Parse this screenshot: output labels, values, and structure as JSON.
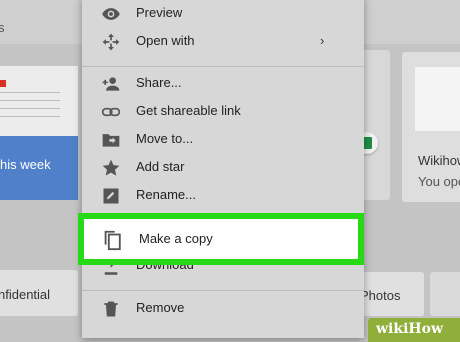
{
  "background": {
    "top_left_text": "s",
    "left_card": {
      "footer_text": "his week"
    },
    "right_card": {
      "title": "Wikihow",
      "subtitle": "You ope"
    },
    "chip_left": "nfidential",
    "chip_right": "Photos"
  },
  "context_menu": {
    "items": [
      {
        "label": "Preview",
        "icon": "eye-icon"
      },
      {
        "label": "Open with",
        "icon": "move-arrows-icon",
        "submenu_indicator": "›"
      },
      {
        "label": "Share...",
        "icon": "person-add-icon"
      },
      {
        "label": "Get shareable link",
        "icon": "link-icon"
      },
      {
        "label": "Move to...",
        "icon": "folder-move-icon"
      },
      {
        "label": "Add star",
        "icon": "star-icon"
      },
      {
        "label": "Rename...",
        "icon": "pencil-icon"
      },
      {
        "label": "Make a copy",
        "icon": "copy-icon",
        "highlighted": true
      },
      {
        "label": "Download",
        "icon": "download-icon"
      },
      {
        "label": "Remove",
        "icon": "trash-icon"
      }
    ]
  },
  "colors": {
    "highlight_border": "#28d916",
    "accent_blue": "#4f80c9",
    "sheets_green": "#1f8e45",
    "watermark_green": "#8fae3a"
  },
  "watermark": "wikiHow"
}
